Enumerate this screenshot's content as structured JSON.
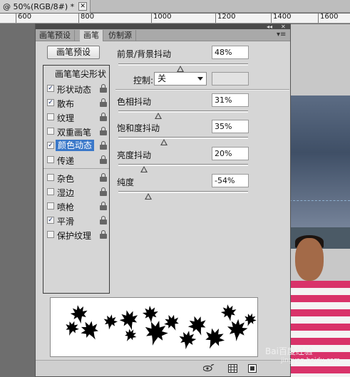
{
  "document": {
    "tab_title": "@ 50%(RGB/8#) *",
    "close_glyph": "✕",
    "ruler_ticks": [
      "600",
      "800",
      "1000",
      "1200",
      "1400",
      "1600"
    ]
  },
  "panel": {
    "collapse_glyph": "◂◂",
    "close_glyph": "✕",
    "tabs": [
      {
        "label": "画笔预设",
        "active": false
      },
      {
        "label": "画笔",
        "active": true
      },
      {
        "label": "仿制源",
        "active": false
      }
    ],
    "menu_glyph": "▾≡",
    "preset_button": "画笔预设",
    "tip_shape_label": "画笔笔尖形状",
    "options": [
      {
        "label": "形状动态",
        "checked": true,
        "selected": false
      },
      {
        "label": "散布",
        "checked": true,
        "selected": false
      },
      {
        "label": "纹理",
        "checked": false,
        "selected": false
      },
      {
        "label": "双重画笔",
        "checked": false,
        "selected": false
      },
      {
        "label": "颜色动态",
        "checked": true,
        "selected": true
      },
      {
        "label": "传递",
        "checked": false,
        "selected": false
      },
      {
        "label": "杂色",
        "checked": false,
        "selected": false
      },
      {
        "label": "湿边",
        "checked": false,
        "selected": false
      },
      {
        "label": "喷枪",
        "checked": false,
        "selected": false
      },
      {
        "label": "平滑",
        "checked": true,
        "selected": false
      },
      {
        "label": "保护纹理",
        "checked": false,
        "selected": false
      }
    ],
    "check_glyph": "✓",
    "controls": {
      "fg_bg_jitter": {
        "label": "前景/背景抖动",
        "value": "48%",
        "fraction": 0.48
      },
      "control": {
        "label": "控制:",
        "value": "关"
      },
      "hue_jitter": {
        "label": "色相抖动",
        "value": "31%",
        "fraction": 0.31
      },
      "saturation_jitter": {
        "label": "饱和度抖动",
        "value": "35%",
        "fraction": 0.35
      },
      "brightness_jitter": {
        "label": "亮度抖动",
        "value": "20%",
        "fraction": 0.2
      },
      "purity": {
        "label": "纯度",
        "value": "-54%",
        "fraction": 0.23
      }
    }
  },
  "watermark": {
    "text": "Bai百度经验",
    "sub": "jingyan.baidu.com"
  }
}
